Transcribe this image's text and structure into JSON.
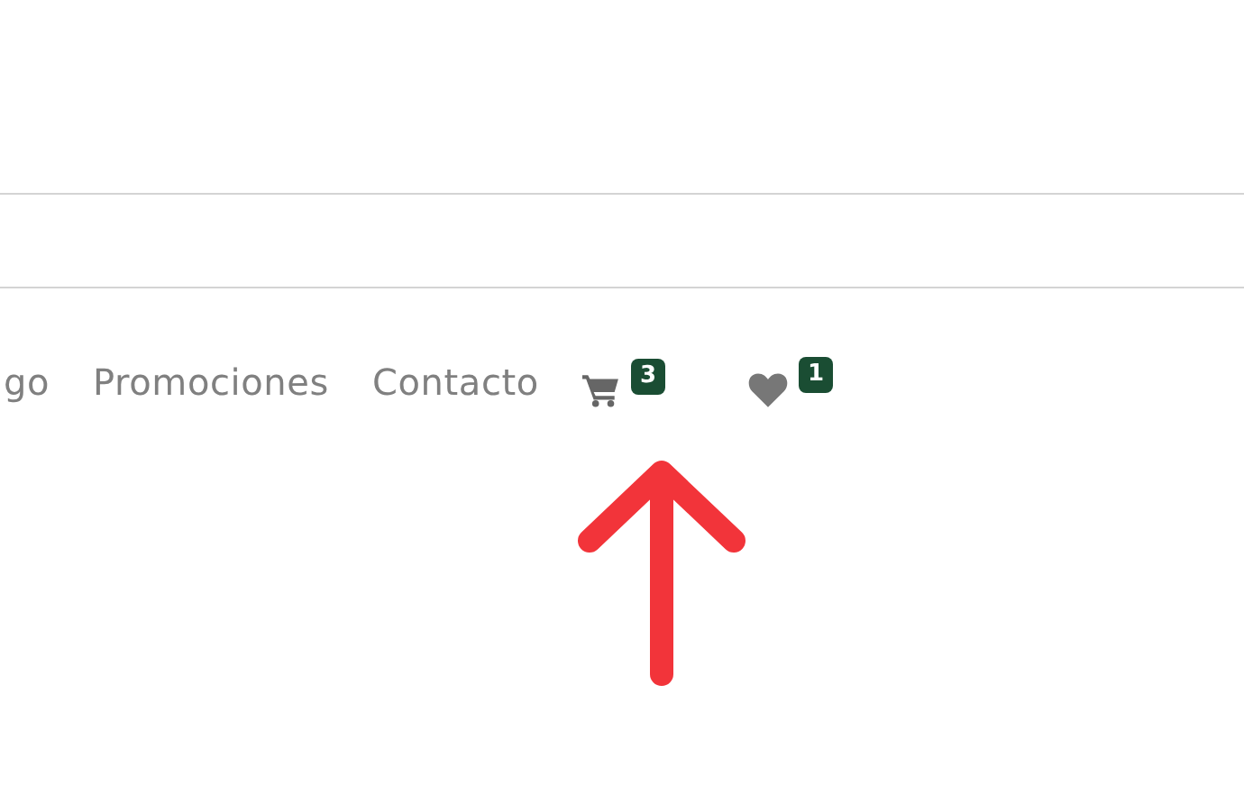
{
  "nav": {
    "links": [
      {
        "label": "go"
      },
      {
        "label": "Promociones"
      },
      {
        "label": "Contacto"
      }
    ],
    "cart": {
      "count": "3"
    },
    "wishlist": {
      "count": "1"
    }
  }
}
